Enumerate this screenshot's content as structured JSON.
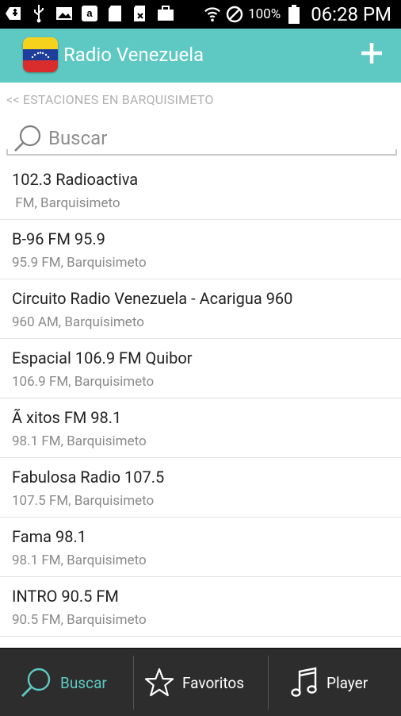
{
  "status": {
    "battery": "100%",
    "time": "06:28 PM"
  },
  "appbar": {
    "title": "Radio Venezuela"
  },
  "breadcrumb": "<< ESTACIONES EN BARQUISIMETO",
  "search": {
    "placeholder": "Buscar"
  },
  "stations": [
    {
      "name": "102.3 Radioactiva",
      "sub": " FM, Barquisimeto"
    },
    {
      "name": "B-96 FM 95.9",
      "sub": "95.9 FM, Barquisimeto"
    },
    {
      "name": "Circuito Radio Venezuela - Acarigua 960",
      "sub": "960 AM, Barquisimeto"
    },
    {
      "name": "Espacial 106.9 FM Quibor",
      "sub": "106.9 FM, Barquisimeto"
    },
    {
      "name": "Ã xitos FM 98.1",
      "sub": "98.1 FM, Barquisimeto"
    },
    {
      "name": "Fabulosa Radio 107.5",
      "sub": "107.5 FM, Barquisimeto"
    },
    {
      "name": "Fama 98.1",
      "sub": "98.1 FM, Barquisimeto"
    },
    {
      "name": "INTRO 90.5 FM",
      "sub": "90.5 FM, Barquisimeto"
    }
  ],
  "tabs": {
    "search": "Buscar",
    "favorites": "Favoritos",
    "player": "Player"
  },
  "colors": {
    "accent": "#5ec9c2",
    "tabbar": "#2d2d2d"
  }
}
